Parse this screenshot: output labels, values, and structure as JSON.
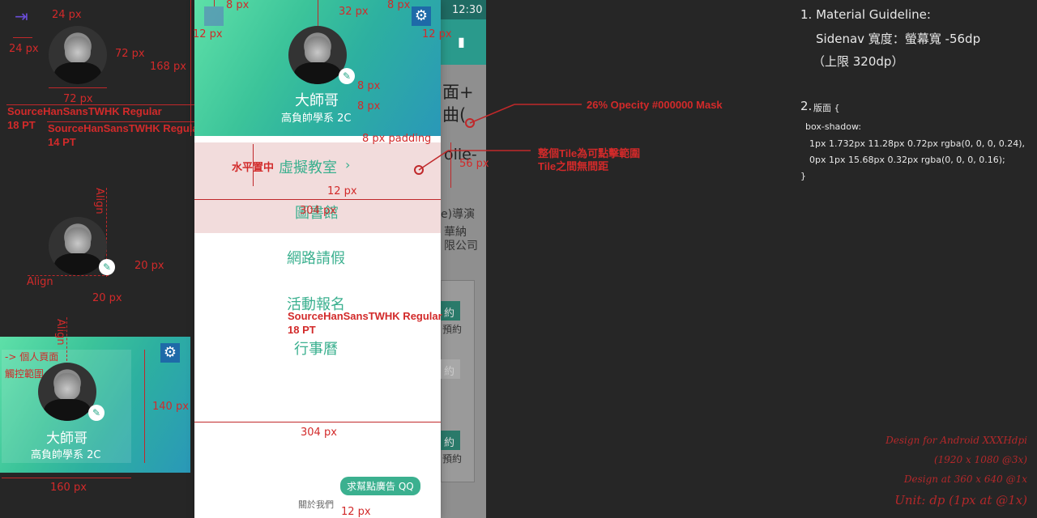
{
  "phone": {
    "status_time": "12:30",
    "header": {
      "name": "大師哥",
      "subtitle": "高負帥學系 2C"
    },
    "menu": [
      {
        "label": "虛擬教室"
      },
      {
        "label": "圖書館"
      },
      {
        "label": "網路請假"
      },
      {
        "label": "活動報名"
      },
      {
        "label": "行事曆"
      }
    ],
    "footer_link": "關於我們",
    "ad_bubble": "求幫點廣告 QQ",
    "behind_texts": [
      "面+",
      "曲(",
      "olle-",
      "e)導演",
      "華納",
      "限公司",
      "約",
      "預約",
      "約",
      "約",
      "預約"
    ]
  },
  "annotations": {
    "top_left": {
      "px24a": "24 px",
      "px24b": "24 px",
      "px72a": "72 px",
      "px72b": "72 px",
      "px168": "168 px",
      "font1_name": "SourceHanSansTWHK Regular",
      "font1_size": "18 PT",
      "font2_name": "SourceHanSansTWHK Regular",
      "font2_size": "14 PT"
    },
    "phone_top": {
      "px8a": "8 px",
      "px32": "32 px",
      "px8b": "8 px",
      "px12a": "12 px",
      "px12b": "12 px",
      "px8c": "8 px",
      "px8d": "8 px",
      "padding": "8 px padding"
    },
    "tile": {
      "center": "水平置中",
      "px12": "12 px",
      "px304": "304 px",
      "px56": "56 px"
    },
    "font3_name": "SourceHanSansTWHK Regular",
    "font3_size": "18 PT",
    "bottom_px304": "304 px",
    "bottom_px12": "12 px",
    "align_a": "Align",
    "align_b": "Align",
    "align_c": "Align",
    "px20a": "20 px",
    "px20b": "20 px",
    "mask_note": "26% Opecity #000000 Mask",
    "tile_note1": "整個Tile為可點擊範圍",
    "tile_note2": "Tile之間無間距",
    "mini": {
      "profile_note1": "-> 個人頁面",
      "profile_note2": "觸控範圍",
      "name": "大師哥",
      "subtitle": "高負帥學系 2C",
      "px140": "140 px",
      "px160": "160 px"
    }
  },
  "guideline": {
    "line1": "1. Material Guideline:",
    "line2": "Sidenav 寬度：螢幕寬 -56dp",
    "line3": "（上限 320dp）",
    "line4_num": "2.",
    "line4": "版面 {",
    "line5": "box-shadow:",
    "line6": "1px 1.732px 11.28px 0.72px rgba(0, 0, 0, 0.24),",
    "line7": "0px 1px 15.68px 0.32px rgba(0, 0, 0, 0.16);",
    "line8": "}"
  },
  "credits": {
    "c1": "Design for Android XXXHdpi",
    "c2": "(1920 x 1080 @3x)",
    "c3": "Design at 360 x 640 @1x",
    "c4": "Unit: dp (1px at @1x)"
  },
  "colors": {
    "accent": "#3bb08f",
    "annotation": "#d22a2a",
    "teal_bar": "#2a9a8c"
  }
}
